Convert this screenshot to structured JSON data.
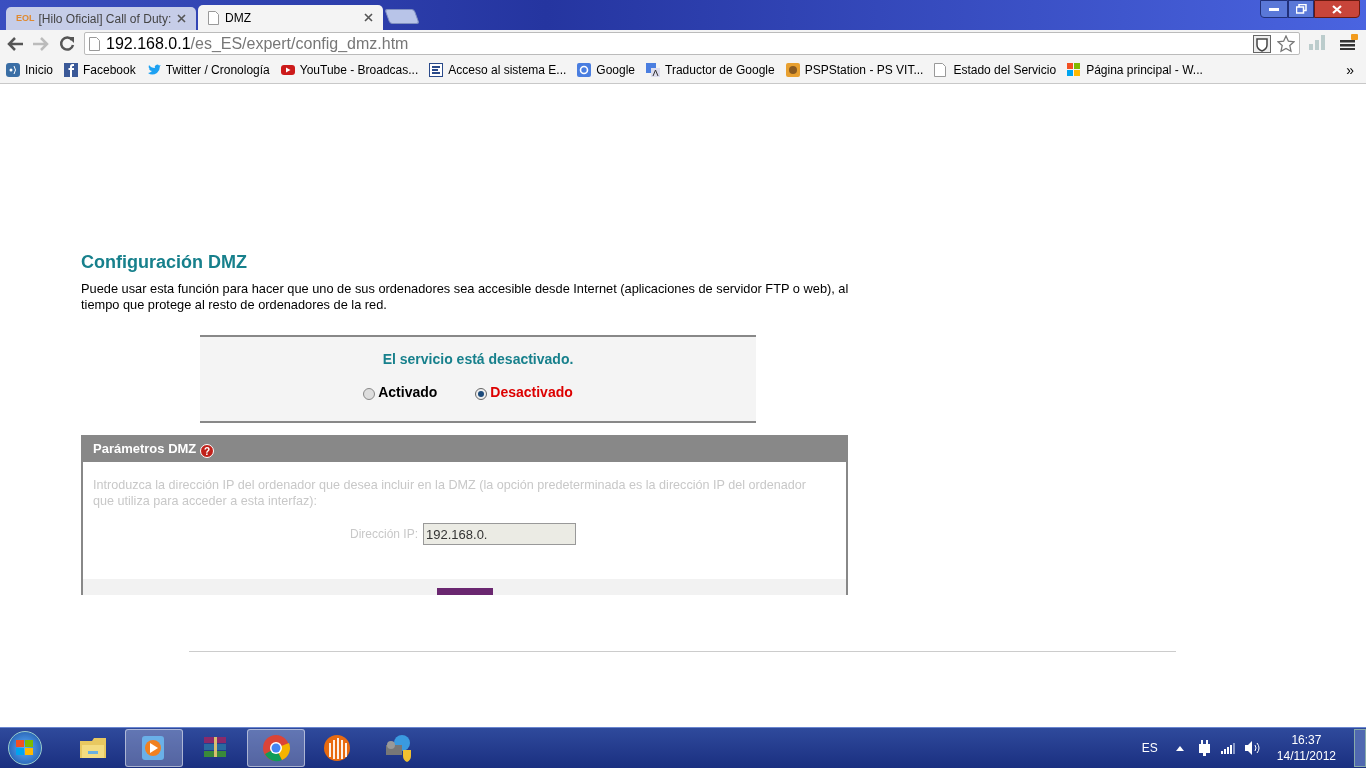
{
  "tabs": [
    {
      "title": "[Hilo Oficial] Call of Duty:",
      "favicon": "EOL",
      "selected": false
    },
    {
      "title": "DMZ",
      "selected": true
    }
  ],
  "address_bar": {
    "host": "192.168.0.1",
    "path": "/es_ES/expert/config_dmz.htm"
  },
  "bookmarks": [
    {
      "label": "Inicio",
      "kind": "apps"
    },
    {
      "label": "Facebook",
      "kind": "facebook"
    },
    {
      "label": "Twitter / Cronología",
      "kind": "twitter"
    },
    {
      "label": "YouTube - Broadcas...",
      "kind": "youtube"
    },
    {
      "label": "Acceso al sistema E...",
      "kind": "site"
    },
    {
      "label": "Google",
      "kind": "google"
    },
    {
      "label": "Traductor de Google",
      "kind": "translate"
    },
    {
      "label": "PSPStation - PS VIT...",
      "kind": "game"
    },
    {
      "label": "Estado del Servicio",
      "kind": "page"
    },
    {
      "label": "Página principal - W...",
      "kind": "windows"
    }
  ],
  "bookmarks_overflow": "»",
  "page": {
    "title": "Configuración DMZ",
    "description": "Puede usar esta función para hacer que uno de sus ordenadores sea accesible desde Internet (aplicaciones de servidor FTP o web), al tiempo que protege al resto de ordenadores de la red.",
    "status": "El servicio está desactivado.",
    "options": [
      {
        "label": "Activado",
        "selected": false
      },
      {
        "label": "Desactivado",
        "selected": true
      }
    ],
    "panel": {
      "title": "Parámetros DMZ",
      "help": "?",
      "text": "Introduzca la dirección IP del ordenador que desea incluir en la DMZ (la opción predeterminada es la dirección IP del ordenador que utiliza para acceder a esta interfaz):",
      "ip_label": "Dirección IP:",
      "ip_value": "192.168.0.",
      "disabled": true
    }
  },
  "taskbar": {
    "apps": [
      {
        "kind": "explorer",
        "selected": false
      },
      {
        "kind": "media",
        "selected": true
      },
      {
        "kind": "archive",
        "selected": false
      },
      {
        "kind": "browser",
        "selected": true
      },
      {
        "kind": "torrent",
        "selected": false
      },
      {
        "kind": "media-center",
        "selected": false
      }
    ],
    "language": "ES",
    "time": "16:37",
    "date": "14/11/2012"
  }
}
